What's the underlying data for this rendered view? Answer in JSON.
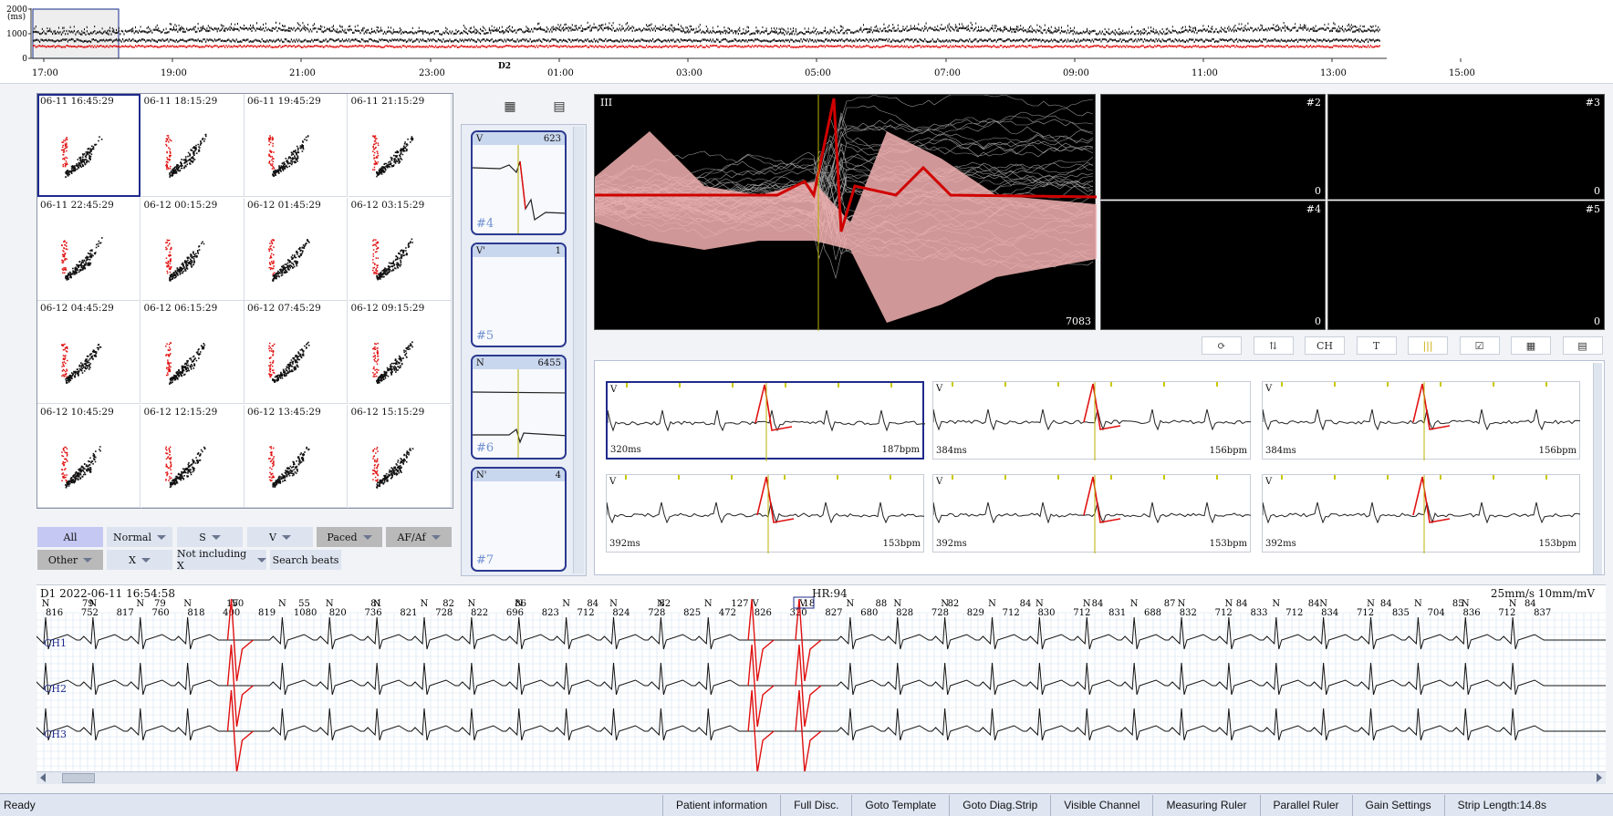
{
  "trend": {
    "y_unit": "(ms)",
    "y_ticks": [
      "2000",
      "1000",
      "0"
    ],
    "lead_label": "D2",
    "time_ticks": [
      "17:00",
      "19:00",
      "21:00",
      "23:00",
      "01:00",
      "03:00",
      "05:00",
      "07:00",
      "09:00",
      "11:00",
      "13:00",
      "15:00"
    ],
    "colors": {
      "rr": "#111111",
      "ectopic": "#e01010"
    }
  },
  "scatter": {
    "timestamps": [
      "06-11 16:45:29",
      "06-11 18:15:29",
      "06-11 19:45:29",
      "06-11 21:15:29",
      "06-11 22:45:29",
      "06-12 00:15:29",
      "06-12 01:45:29",
      "06-12 03:15:29",
      "06-12 04:45:29",
      "06-12 06:15:29",
      "06-12 07:45:29",
      "06-12 09:15:29",
      "06-12 10:45:29",
      "06-12 12:15:29",
      "06-12 13:45:29",
      "06-12 15:15:29"
    ]
  },
  "filters": {
    "row1": [
      {
        "label": "All",
        "caret": false
      },
      {
        "label": "Normal",
        "caret": true
      },
      {
        "label": "S",
        "caret": true
      },
      {
        "label": "V",
        "caret": true
      },
      {
        "label": "Paced",
        "caret": true
      },
      {
        "label": "AF/Af",
        "caret": true
      }
    ],
    "row2": [
      {
        "label": "Other",
        "caret": true
      },
      {
        "label": "X",
        "caret": true
      },
      {
        "label": "Not including X",
        "caret": true
      },
      {
        "label": "Search beats",
        "caret": false
      }
    ]
  },
  "templates": [
    {
      "type": "V",
      "count": "623",
      "num": "#4"
    },
    {
      "type": "V'",
      "count": "1",
      "num": "#5"
    },
    {
      "type": "N",
      "count": "6455",
      "num": "#6"
    },
    {
      "type": "N'",
      "count": "4",
      "num": "#7"
    }
  ],
  "overlay": {
    "main": {
      "lead": "III",
      "count": "7083"
    },
    "cells": [
      {
        "label": "#2",
        "count": "0"
      },
      {
        "label": "#3",
        "count": "0"
      },
      {
        "label": "#4",
        "count": "0"
      },
      {
        "label": "#5",
        "count": "0"
      }
    ]
  },
  "toolbar": {
    "ch_label": "CH"
  },
  "strips": [
    {
      "type": "V",
      "ms": "320ms",
      "bpm": "187bpm"
    },
    {
      "type": "V",
      "ms": "384ms",
      "bpm": "156bpm"
    },
    {
      "type": "V",
      "ms": "384ms",
      "bpm": "156bpm"
    },
    {
      "type": "V",
      "ms": "392ms",
      "bpm": "153bpm"
    },
    {
      "type": "V",
      "ms": "392ms",
      "bpm": "153bpm"
    },
    {
      "type": "V",
      "ms": "392ms",
      "bpm": "153bpm"
    }
  ],
  "ecg": {
    "lead": "D1",
    "datetime": "2022-06-11 16:54:58",
    "hr": "HR:94",
    "speed": "25mm/s 10mm/mV",
    "channels": [
      "CH1",
      "CH2",
      "CH3"
    ],
    "beats": [
      "N",
      "N",
      "N",
      "N",
      "V",
      "N",
      "N",
      "N",
      "N",
      "N",
      "N",
      "N",
      "N",
      "N",
      "N",
      "V",
      "V",
      "N",
      "N",
      "N",
      "N",
      "N",
      "N",
      "N",
      "N",
      "N",
      "N",
      "N",
      "N",
      "N",
      "N",
      "N"
    ],
    "rr": [
      "79",
      "79",
      "150",
      "55",
      "81",
      "82",
      "86",
      "84",
      "82",
      "127",
      "18",
      "88",
      "82",
      "84",
      "84",
      "87",
      "84",
      "84",
      "84",
      "85",
      "84"
    ],
    "ms": [
      "816",
      "752",
      "817",
      "760",
      "818",
      "400",
      "819",
      "1080",
      "820",
      "736",
      "821",
      "728",
      "822",
      "696",
      "823",
      "712",
      "824",
      "728",
      "825",
      "472",
      "826",
      "320",
      "827",
      "680",
      "828",
      "728",
      "829",
      "712",
      "830",
      "712",
      "831",
      "688",
      "832",
      "712",
      "833",
      "712",
      "834",
      "712",
      "835",
      "704",
      "836",
      "712",
      "837"
    ],
    "colors": {
      "normal": "#111111",
      "ventricular": "#e01010"
    }
  },
  "statusbar": {
    "ready": "Ready",
    "buttons": [
      "Patient information",
      "Full Disc.",
      "Goto Template",
      "Goto Diag.Strip",
      "Visible Channel",
      "Measuring Ruler",
      "Parallel Ruler",
      "Gain Settings",
      "Strip Length:14.8s"
    ]
  }
}
